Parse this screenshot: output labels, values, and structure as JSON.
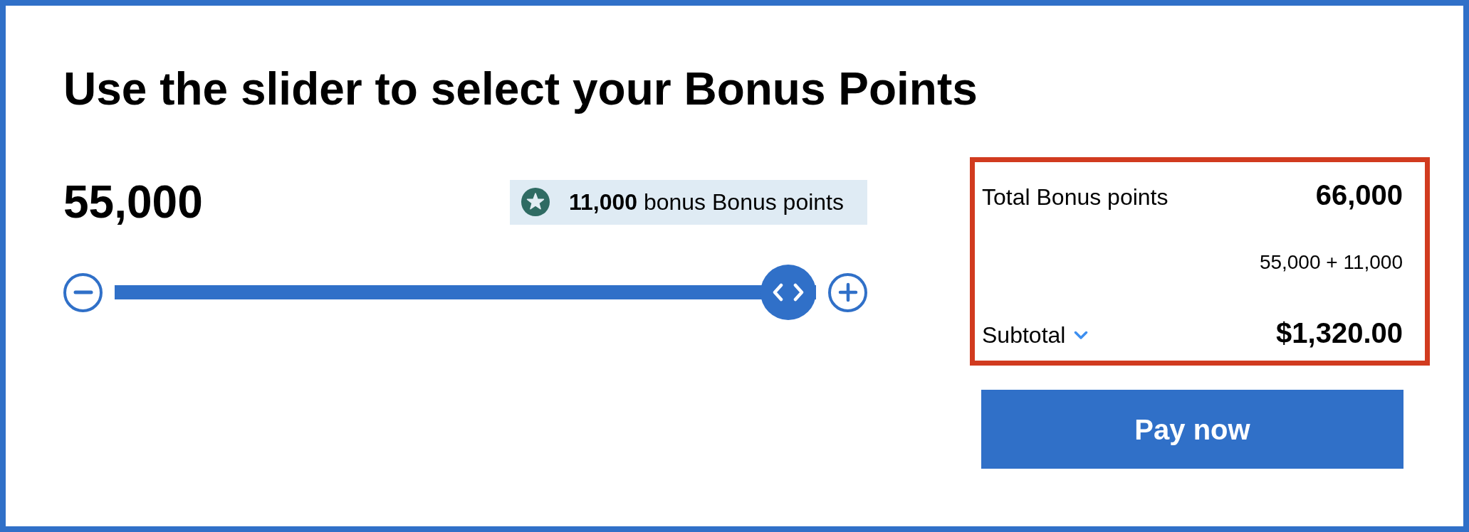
{
  "heading": "Use the slider to select your Bonus Points",
  "points": {
    "value": "55,000",
    "bonus_badge": "**11,000** bonus Bonus points"
  },
  "slider": {
    "level": 1
  },
  "summary": {
    "total_label": "Total Bonus points",
    "total_value": "66,000",
    "breakdown": "55,000 + 11,000",
    "subtotal_label": "Subtotal",
    "subtotal_expanded": false,
    "subtotal_value": "$1,320.00"
  },
  "pay_button": "Pay now"
}
